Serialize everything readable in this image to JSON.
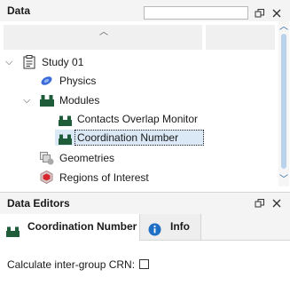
{
  "data_panel": {
    "title": "Data",
    "search": {
      "value": "",
      "placeholder": ""
    },
    "tree": [
      {
        "label": "Study 01",
        "icon": "clipboard-icon",
        "expanded": true
      },
      {
        "label": "Physics",
        "icon": "physics-icon"
      },
      {
        "label": "Modules",
        "icon": "modules-icon",
        "expanded": true
      },
      {
        "label": "Contacts Overlap Monitor",
        "icon": "module-icon"
      },
      {
        "label": "Coordination Number",
        "icon": "module-icon",
        "selected": true
      },
      {
        "label": "Geometries",
        "icon": "geometries-icon"
      },
      {
        "label": "Regions of Interest",
        "icon": "regions-icon"
      }
    ]
  },
  "editors_panel": {
    "title": "Data Editors",
    "tabs": [
      {
        "label": "Coordination Number",
        "icon": "module-icon",
        "active": true
      },
      {
        "label": "Info",
        "icon": "info-icon",
        "active": false
      }
    ],
    "option": {
      "label": "Calculate inter-group CRN:",
      "checked": false
    }
  },
  "colors": {
    "module_green": "#1e5c3a",
    "selection_bg": "#dbe9f6",
    "accent_blue": "#1f6fc5"
  }
}
